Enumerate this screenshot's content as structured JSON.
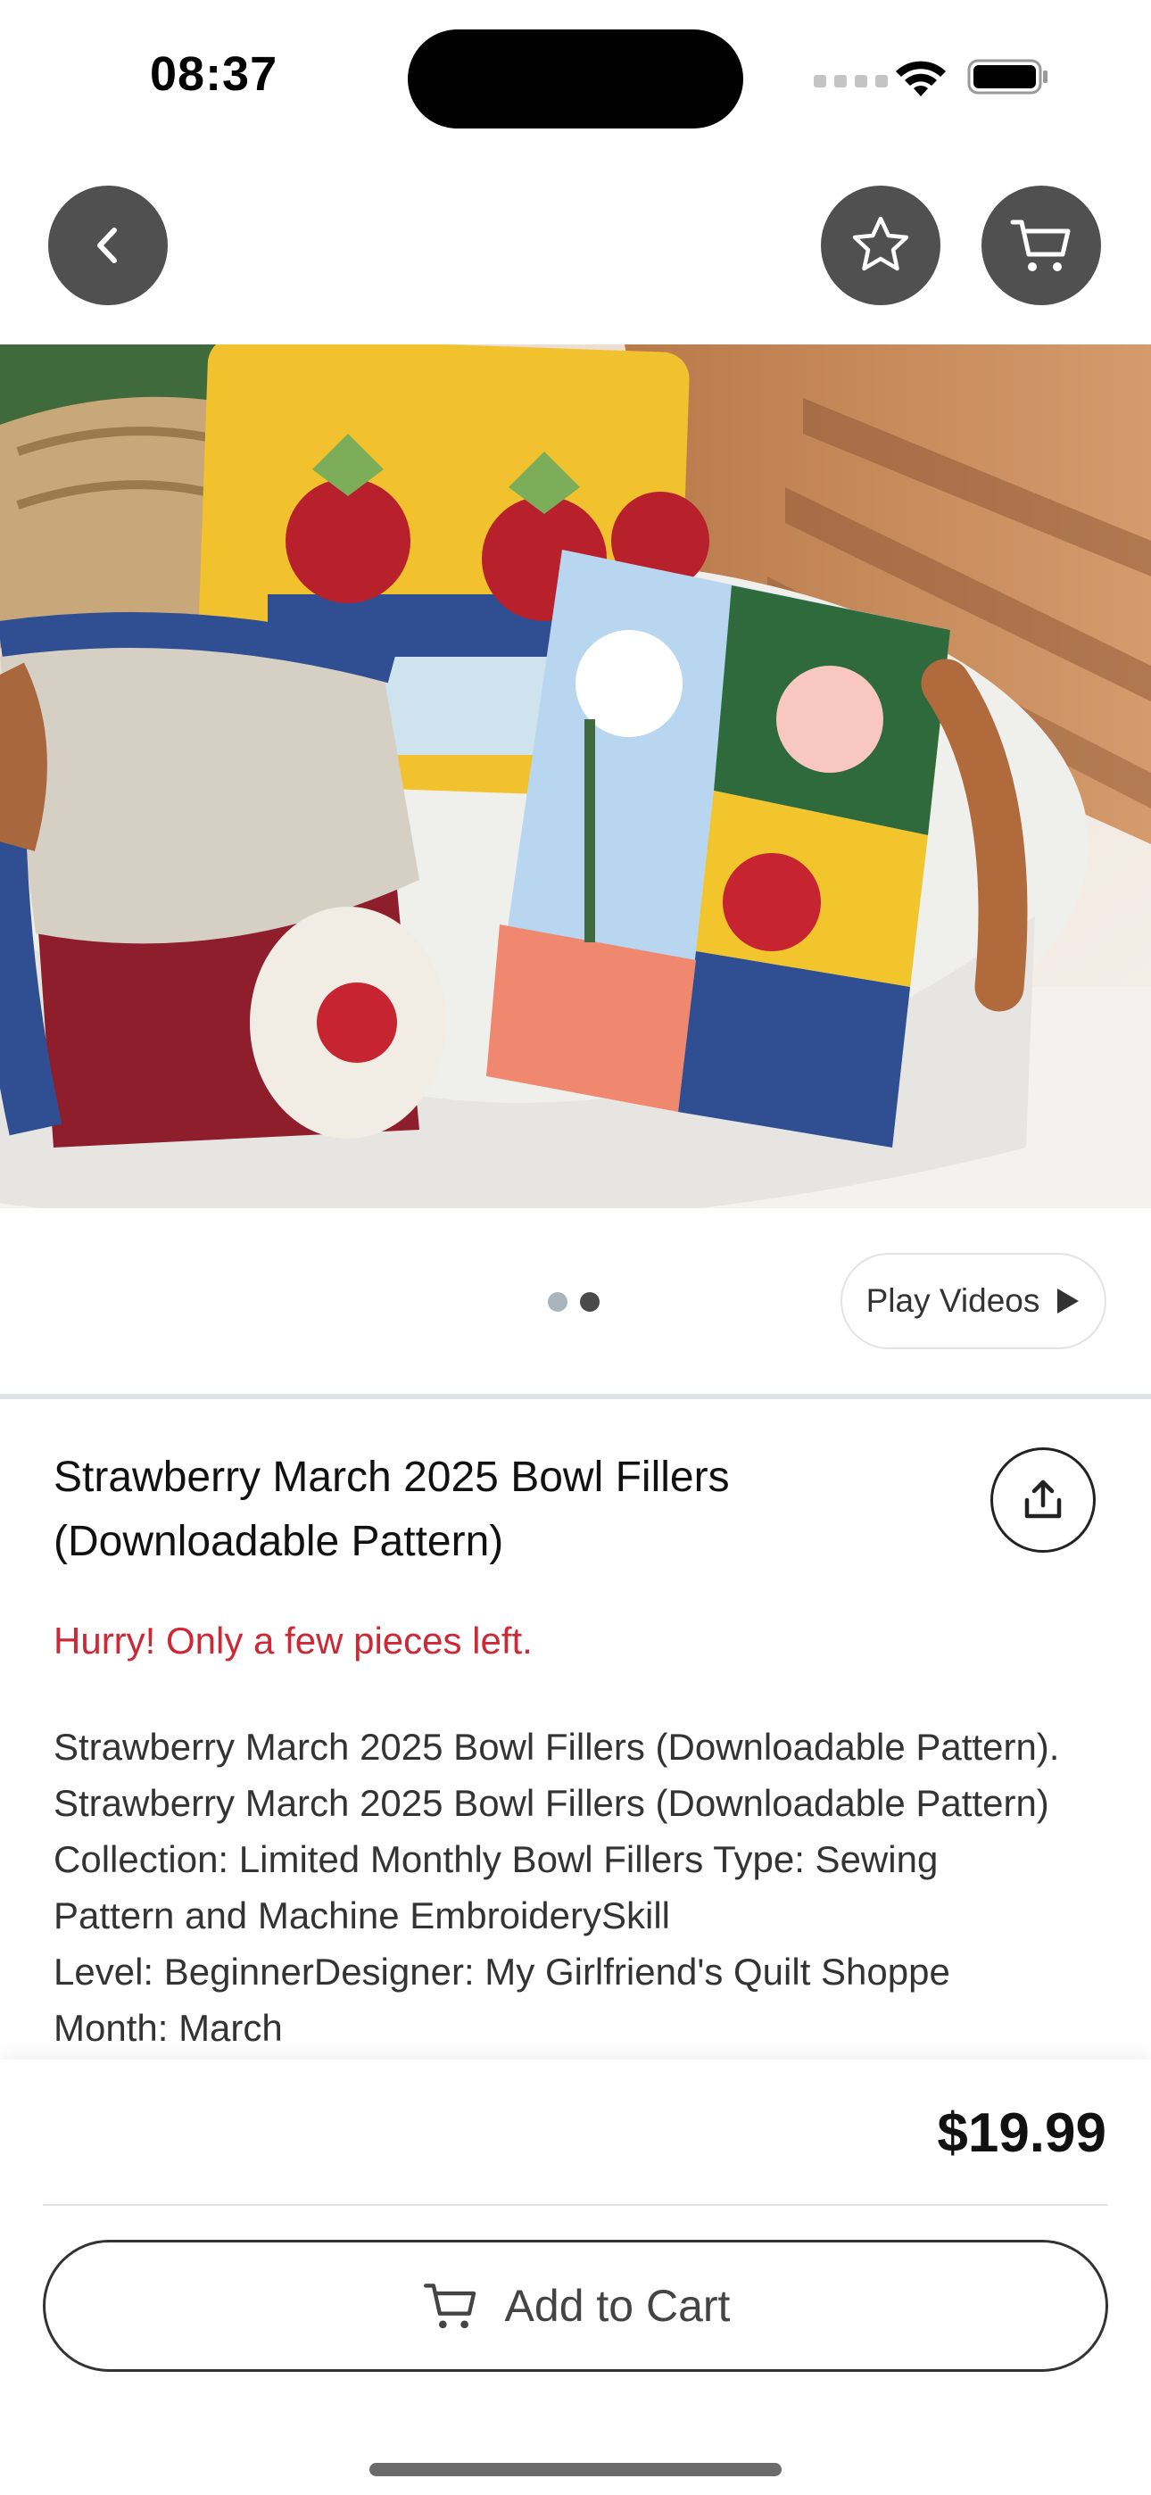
{
  "status_bar": {
    "time": "08:37"
  },
  "nav": {
    "back_icon": "chevron-left-icon",
    "favorite_icon": "star-icon",
    "cart_icon": "cart-icon"
  },
  "gallery": {
    "image_count": 2,
    "active_index": 1,
    "play_videos_label": "Play Videos"
  },
  "product": {
    "title": "Strawberry March 2025 Bowl Fillers (Downloadable Pattern)",
    "stock_warning": "Hurry! Only a few pieces left.",
    "description_lines": [
      "Strawberry March 2025 Bowl Fillers (Downloadable Pattern).",
      "Strawberry March 2025 Bowl Fillers (Downloadable Pattern)",
      "Collection: Limited Monthly Bowl Fillers Type: Sewing",
      "Pattern and Machine EmbroiderySkill",
      "Level: BeginnerDesigner: My Girlfriend's Quilt Shoppe",
      "Month: March"
    ],
    "price": "$19.99"
  },
  "actions": {
    "add_to_cart_label": "Add to Cart"
  },
  "colors": {
    "nav_button_bg": "#505050",
    "stock_warning": "#cc2836",
    "dot_active": "#4a4a4a",
    "dot_inactive": "#a9b4bd"
  }
}
